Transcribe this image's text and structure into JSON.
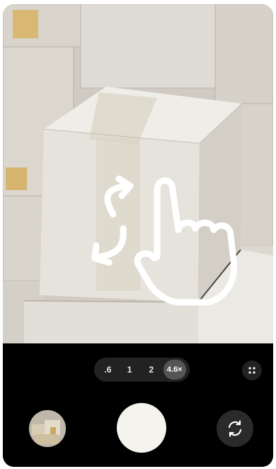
{
  "camera": {
    "zoom_options": [
      {
        "label": ".6"
      },
      {
        "label": "1"
      },
      {
        "label": "2"
      },
      {
        "label": "4.6×"
      }
    ],
    "selected_zoom": "4.6×"
  },
  "icons": {
    "gesture": "pinch-rotate-hand-icon",
    "more": "grid-dots-icon",
    "switch": "camera-switch-icon"
  },
  "colors": {
    "controls_bg": "#000000",
    "shutter": "#f4f3ee"
  }
}
